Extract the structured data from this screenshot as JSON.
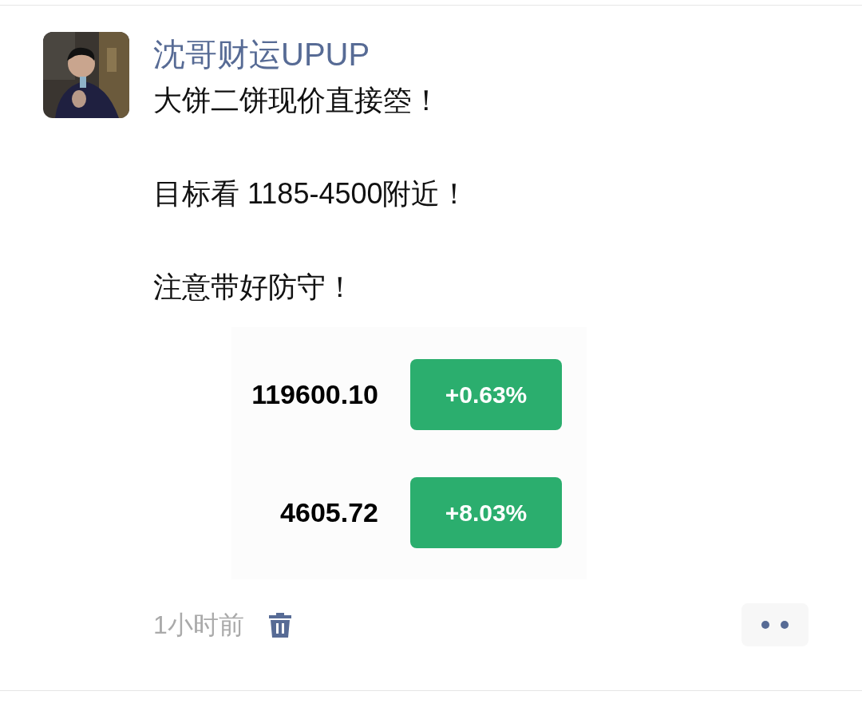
{
  "post": {
    "author": "沈哥财运UPUP",
    "paragraphs": [
      "大饼二饼现价直接箜！",
      "目标看 1185-4500附近！",
      "注意带好防守！"
    ],
    "attachment": {
      "rows": [
        {
          "price": "119600.10",
          "change": "+0.63%"
        },
        {
          "price": "4605.72",
          "change": "+8.03%"
        }
      ]
    },
    "time": "1小时前"
  }
}
